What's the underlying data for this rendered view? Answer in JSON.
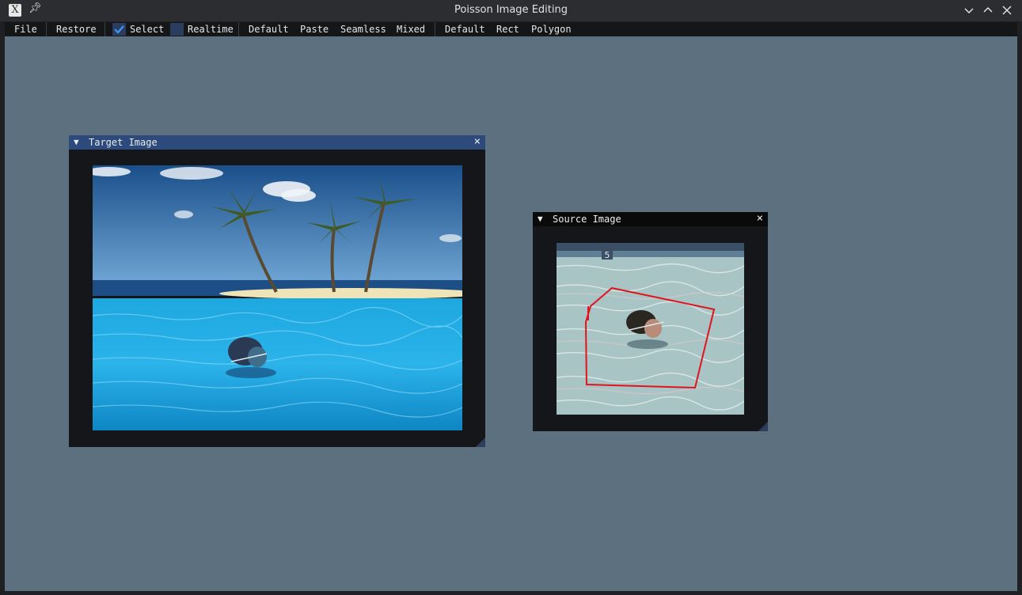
{
  "window": {
    "title": "Poisson Image Editing"
  },
  "menu": {
    "file": "File",
    "restore": "Restore",
    "select": "Select",
    "select_checked": true,
    "realtime": "Realtime",
    "realtime_checked": false,
    "blend_modes": [
      "Default",
      "Paste",
      "Seamless",
      "Mixed"
    ],
    "shape_modes": [
      "Default",
      "Rect",
      "Polygon"
    ]
  },
  "target_window": {
    "title": "Target Image",
    "collapse_icon": "triangle-down-icon",
    "close_icon": "close-icon"
  },
  "source_window": {
    "title": "Source Image",
    "collapse_icon": "triangle-down-icon",
    "close_icon": "close-icon"
  },
  "source_image": {
    "lane_marker": "5"
  },
  "colors": {
    "workspace": "#5c7080",
    "active_header": "#2c4a7c",
    "inactive_header": "#0a0a0a",
    "selection_polygon": "#e0141c"
  }
}
